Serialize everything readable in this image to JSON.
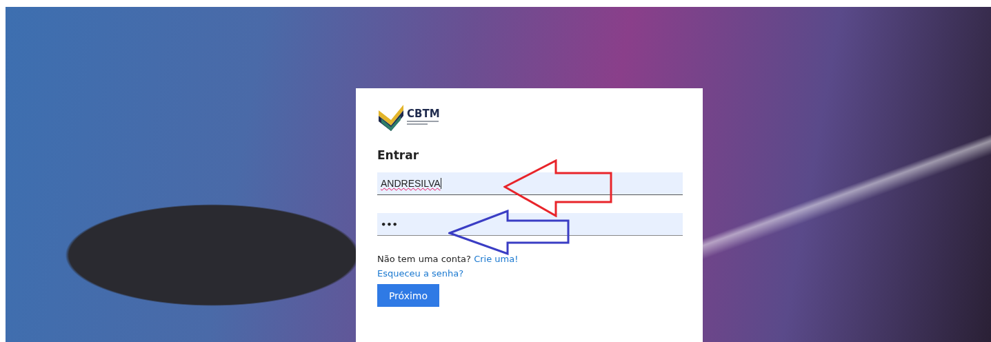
{
  "logo": {
    "text": "CBTM"
  },
  "heading": "Entrar",
  "username_field": {
    "value": "ANDRESILVA",
    "focused": true
  },
  "password_field": {
    "value": "•••"
  },
  "signup_prompt": {
    "text": "Não tem uma conta?",
    "link": "Crie uma!"
  },
  "forgot_link": "Esqueceu a senha?",
  "next_button": "Próximo"
}
